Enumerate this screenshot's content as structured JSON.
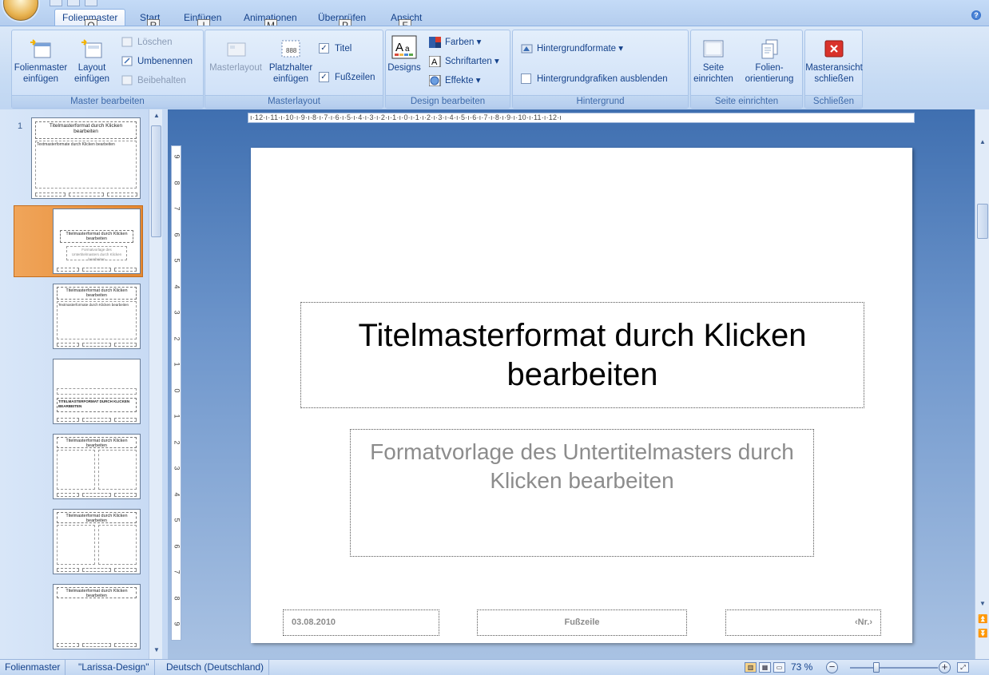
{
  "tabs": {
    "folienmaster": "Folienmaster",
    "start": "Start",
    "einfuegen": "Einfügen",
    "animationen": "Animationen",
    "ueberpruefen": "Überprüfen",
    "ansicht": "Ansicht"
  },
  "keytips": {
    "o": "O",
    "r": "R",
    "i": "I",
    "m": "M",
    "p": "P",
    "f": "F"
  },
  "ribbon": {
    "master_bearbeiten": {
      "label": "Master bearbeiten",
      "folienmaster_einfuegen": "Folienmaster einfügen",
      "layout_einfuegen": "Layout einfügen",
      "loeschen": "Löschen",
      "umbenennen": "Umbenennen",
      "beibehalten": "Beibehalten"
    },
    "masterlayout": {
      "label": "Masterlayout",
      "masterlayout": "Masterlayout",
      "platzhalter_einfuegen": "Platzhalter einfügen",
      "titel": "Titel",
      "fusszeilen": "Fußzeilen"
    },
    "design_bearbeiten": {
      "label": "Design bearbeiten",
      "designs": "Designs",
      "farben": "Farben",
      "schriftarten": "Schriftarten",
      "effekte": "Effekte"
    },
    "hintergrund": {
      "label": "Hintergrund",
      "hintergrundformate": "Hintergrundformate",
      "hintergrundgrafiken_ausblenden": "Hintergrundgrafiken ausblenden"
    },
    "seite_einrichten": {
      "label": "Seite einrichten",
      "seite_einrichten_btn": "Seite einrichten",
      "folienorientierung": "Folien- orientierung"
    },
    "schliessen": {
      "label": "Schließen",
      "masteransicht_schliessen": "Masteransicht schließen"
    }
  },
  "thumbnails": {
    "slide_number": "1",
    "master_title": "Titelmasterformat durch Klicken bearbeiten",
    "master_body": "Textmasterformate durch Klicken bearbeiten",
    "layout_title": "Titelmasterformat durch Klicken bearbeiten",
    "layout_sub": "Formatvorlage des Untertitelmasters durch Klicken bearbeiten",
    "section_title": "TITELMASTERFORMAT DURCH KLICKEN BEARBEITEN"
  },
  "ruler": {
    "horizontal": "ı·12·ı·11·ı·10·ı·9·ı·8·ı·7·ı·6·ı·5·ı·4·ı·3·ı·2·ı·1·ı·0·ı·1·ı·2·ı·3·ı·4·ı·5·ı·6·ı·7·ı·8·ı·9·ı·10·ı·11·ı·12·ı",
    "vertical": [
      "9",
      "8",
      "7",
      "6",
      "5",
      "4",
      "3",
      "2",
      "1",
      "0",
      "1",
      "2",
      "3",
      "4",
      "5",
      "6",
      "7",
      "8",
      "9"
    ]
  },
  "slide": {
    "title": "Titelmasterformat durch Klicken bearbeiten",
    "subtitle": "Formatvorlage des Untertitelmasters durch Klicken bearbeiten",
    "date": "03.08.2010",
    "footer": "Fußzeile",
    "number": "‹Nr.›"
  },
  "statusbar": {
    "view": "Folienmaster",
    "design": "\"Larissa-Design\"",
    "language": "Deutsch (Deutschland)",
    "zoom": "73 %",
    "zoom_fraction": 0.3
  },
  "colors": {
    "accent": "#15428b",
    "ribbon": "#c5daf3",
    "selected_thumb": "#e48832",
    "close_red": "#d9322b"
  }
}
